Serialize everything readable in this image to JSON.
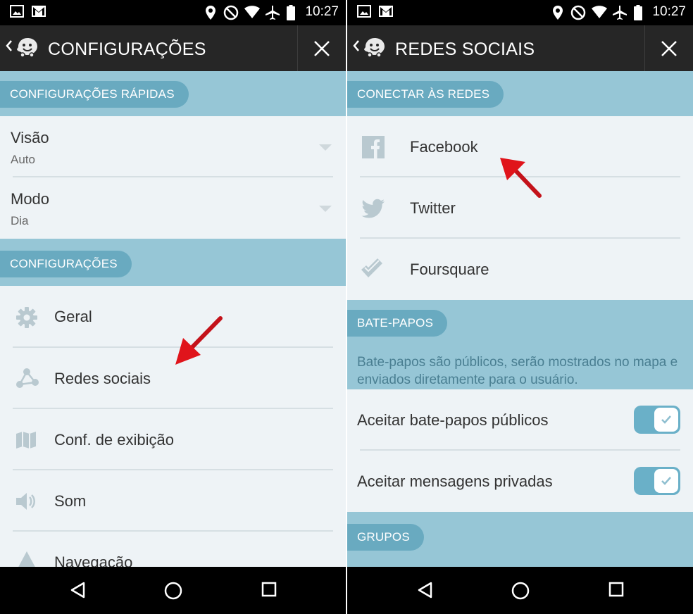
{
  "status_bar": {
    "time": "10:27"
  },
  "left_screen": {
    "title": "CONFIGURAÇÕES",
    "quick_section": "CONFIGURAÇÕES RÁPIDAS",
    "quick_items": [
      {
        "label": "Visão",
        "value": "Auto"
      },
      {
        "label": "Modo",
        "value": "Dia"
      }
    ],
    "settings_section": "CONFIGURAÇÕES",
    "settings_items": [
      {
        "label": "Geral",
        "icon": "gear-icon"
      },
      {
        "label": "Redes sociais",
        "icon": "share-network-icon"
      },
      {
        "label": "Conf. de exibição",
        "icon": "map-icon"
      },
      {
        "label": "Som",
        "icon": "speaker-icon"
      },
      {
        "label": "Navegação",
        "icon": "navigation-icon"
      }
    ]
  },
  "right_screen": {
    "title": "REDES SOCIAIS",
    "connect_section": "CONECTAR ÀS REDES",
    "networks": [
      {
        "label": "Facebook",
        "icon": "facebook-icon"
      },
      {
        "label": "Twitter",
        "icon": "twitter-icon"
      },
      {
        "label": "Foursquare",
        "icon": "foursquare-icon"
      }
    ],
    "chat_section": "BATE-PAPOS",
    "chat_description": "Bate-papos são públicos, serão mostrados no mapa e enviados diretamente para o usuário.",
    "chat_toggles": [
      {
        "label": "Aceitar bate-papos públicos",
        "on": true
      },
      {
        "label": "Aceitar mensagens privadas",
        "on": true
      }
    ],
    "groups_section": "GRUPOS"
  },
  "colors": {
    "section_band": "#96c6d6",
    "section_pill": "#69aac0",
    "list_bg": "#eef3f6",
    "appbar": "#262626",
    "annotation_arrow": "#e0141b"
  }
}
